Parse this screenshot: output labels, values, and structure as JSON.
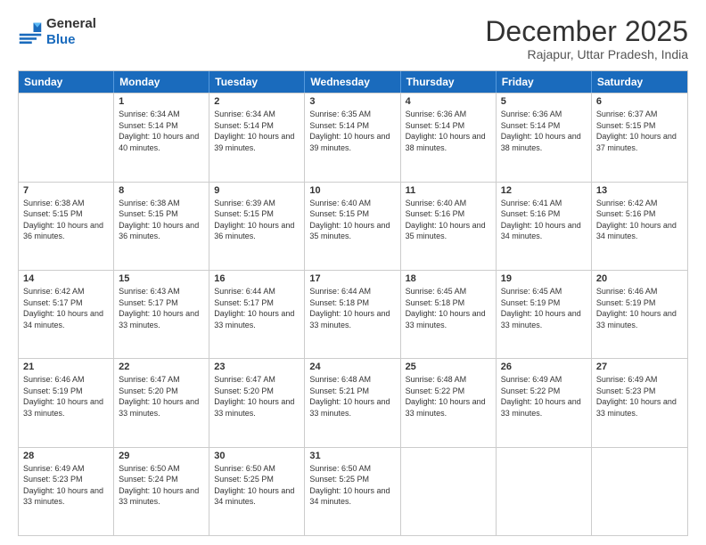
{
  "header": {
    "logo_general": "General",
    "logo_blue": "Blue",
    "title": "December 2025",
    "location": "Rajapur, Uttar Pradesh, India"
  },
  "days_of_week": [
    "Sunday",
    "Monday",
    "Tuesday",
    "Wednesday",
    "Thursday",
    "Friday",
    "Saturday"
  ],
  "weeks": [
    [
      {
        "day": "",
        "sunrise": "",
        "sunset": "",
        "daylight": ""
      },
      {
        "day": "1",
        "sunrise": "Sunrise: 6:34 AM",
        "sunset": "Sunset: 5:14 PM",
        "daylight": "Daylight: 10 hours and 40 minutes."
      },
      {
        "day": "2",
        "sunrise": "Sunrise: 6:34 AM",
        "sunset": "Sunset: 5:14 PM",
        "daylight": "Daylight: 10 hours and 39 minutes."
      },
      {
        "day": "3",
        "sunrise": "Sunrise: 6:35 AM",
        "sunset": "Sunset: 5:14 PM",
        "daylight": "Daylight: 10 hours and 39 minutes."
      },
      {
        "day": "4",
        "sunrise": "Sunrise: 6:36 AM",
        "sunset": "Sunset: 5:14 PM",
        "daylight": "Daylight: 10 hours and 38 minutes."
      },
      {
        "day": "5",
        "sunrise": "Sunrise: 6:36 AM",
        "sunset": "Sunset: 5:14 PM",
        "daylight": "Daylight: 10 hours and 38 minutes."
      },
      {
        "day": "6",
        "sunrise": "Sunrise: 6:37 AM",
        "sunset": "Sunset: 5:15 PM",
        "daylight": "Daylight: 10 hours and 37 minutes."
      }
    ],
    [
      {
        "day": "7",
        "sunrise": "Sunrise: 6:38 AM",
        "sunset": "Sunset: 5:15 PM",
        "daylight": "Daylight: 10 hours and 36 minutes."
      },
      {
        "day": "8",
        "sunrise": "Sunrise: 6:38 AM",
        "sunset": "Sunset: 5:15 PM",
        "daylight": "Daylight: 10 hours and 36 minutes."
      },
      {
        "day": "9",
        "sunrise": "Sunrise: 6:39 AM",
        "sunset": "Sunset: 5:15 PM",
        "daylight": "Daylight: 10 hours and 36 minutes."
      },
      {
        "day": "10",
        "sunrise": "Sunrise: 6:40 AM",
        "sunset": "Sunset: 5:15 PM",
        "daylight": "Daylight: 10 hours and 35 minutes."
      },
      {
        "day": "11",
        "sunrise": "Sunrise: 6:40 AM",
        "sunset": "Sunset: 5:16 PM",
        "daylight": "Daylight: 10 hours and 35 minutes."
      },
      {
        "day": "12",
        "sunrise": "Sunrise: 6:41 AM",
        "sunset": "Sunset: 5:16 PM",
        "daylight": "Daylight: 10 hours and 34 minutes."
      },
      {
        "day": "13",
        "sunrise": "Sunrise: 6:42 AM",
        "sunset": "Sunset: 5:16 PM",
        "daylight": "Daylight: 10 hours and 34 minutes."
      }
    ],
    [
      {
        "day": "14",
        "sunrise": "Sunrise: 6:42 AM",
        "sunset": "Sunset: 5:17 PM",
        "daylight": "Daylight: 10 hours and 34 minutes."
      },
      {
        "day": "15",
        "sunrise": "Sunrise: 6:43 AM",
        "sunset": "Sunset: 5:17 PM",
        "daylight": "Daylight: 10 hours and 33 minutes."
      },
      {
        "day": "16",
        "sunrise": "Sunrise: 6:44 AM",
        "sunset": "Sunset: 5:17 PM",
        "daylight": "Daylight: 10 hours and 33 minutes."
      },
      {
        "day": "17",
        "sunrise": "Sunrise: 6:44 AM",
        "sunset": "Sunset: 5:18 PM",
        "daylight": "Daylight: 10 hours and 33 minutes."
      },
      {
        "day": "18",
        "sunrise": "Sunrise: 6:45 AM",
        "sunset": "Sunset: 5:18 PM",
        "daylight": "Daylight: 10 hours and 33 minutes."
      },
      {
        "day": "19",
        "sunrise": "Sunrise: 6:45 AM",
        "sunset": "Sunset: 5:19 PM",
        "daylight": "Daylight: 10 hours and 33 minutes."
      },
      {
        "day": "20",
        "sunrise": "Sunrise: 6:46 AM",
        "sunset": "Sunset: 5:19 PM",
        "daylight": "Daylight: 10 hours and 33 minutes."
      }
    ],
    [
      {
        "day": "21",
        "sunrise": "Sunrise: 6:46 AM",
        "sunset": "Sunset: 5:19 PM",
        "daylight": "Daylight: 10 hours and 33 minutes."
      },
      {
        "day": "22",
        "sunrise": "Sunrise: 6:47 AM",
        "sunset": "Sunset: 5:20 PM",
        "daylight": "Daylight: 10 hours and 33 minutes."
      },
      {
        "day": "23",
        "sunrise": "Sunrise: 6:47 AM",
        "sunset": "Sunset: 5:20 PM",
        "daylight": "Daylight: 10 hours and 33 minutes."
      },
      {
        "day": "24",
        "sunrise": "Sunrise: 6:48 AM",
        "sunset": "Sunset: 5:21 PM",
        "daylight": "Daylight: 10 hours and 33 minutes."
      },
      {
        "day": "25",
        "sunrise": "Sunrise: 6:48 AM",
        "sunset": "Sunset: 5:22 PM",
        "daylight": "Daylight: 10 hours and 33 minutes."
      },
      {
        "day": "26",
        "sunrise": "Sunrise: 6:49 AM",
        "sunset": "Sunset: 5:22 PM",
        "daylight": "Daylight: 10 hours and 33 minutes."
      },
      {
        "day": "27",
        "sunrise": "Sunrise: 6:49 AM",
        "sunset": "Sunset: 5:23 PM",
        "daylight": "Daylight: 10 hours and 33 minutes."
      }
    ],
    [
      {
        "day": "28",
        "sunrise": "Sunrise: 6:49 AM",
        "sunset": "Sunset: 5:23 PM",
        "daylight": "Daylight: 10 hours and 33 minutes."
      },
      {
        "day": "29",
        "sunrise": "Sunrise: 6:50 AM",
        "sunset": "Sunset: 5:24 PM",
        "daylight": "Daylight: 10 hours and 33 minutes."
      },
      {
        "day": "30",
        "sunrise": "Sunrise: 6:50 AM",
        "sunset": "Sunset: 5:25 PM",
        "daylight": "Daylight: 10 hours and 34 minutes."
      },
      {
        "day": "31",
        "sunrise": "Sunrise: 6:50 AM",
        "sunset": "Sunset: 5:25 PM",
        "daylight": "Daylight: 10 hours and 34 minutes."
      },
      {
        "day": "",
        "sunrise": "",
        "sunset": "",
        "daylight": ""
      },
      {
        "day": "",
        "sunrise": "",
        "sunset": "",
        "daylight": ""
      },
      {
        "day": "",
        "sunrise": "",
        "sunset": "",
        "daylight": ""
      }
    ]
  ]
}
